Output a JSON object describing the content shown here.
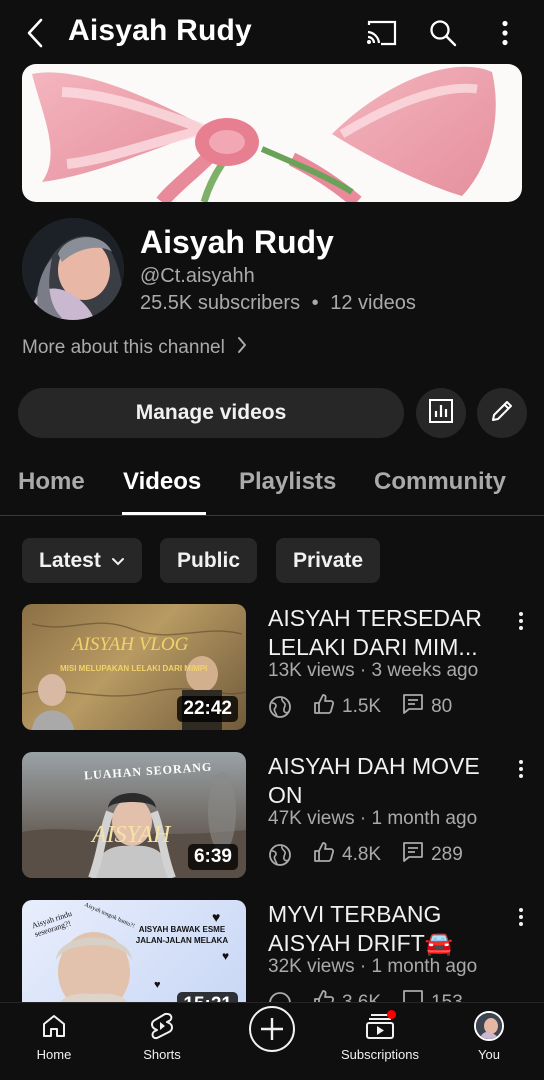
{
  "header": {
    "title": "Aisyah Rudy",
    "icons": [
      "back-icon",
      "cast-icon",
      "search-icon",
      "more-vert-icon"
    ]
  },
  "channel": {
    "name": "Aisyah Rudy",
    "handle": "@Ct.aisyahh",
    "subscribers": "25.5K subscribers",
    "separator": "•",
    "videos": "12 videos",
    "more_link": "More about this channel"
  },
  "actions": {
    "manage_label": "Manage videos",
    "icons": [
      "analytics-icon",
      "edit-icon"
    ]
  },
  "tabs": [
    {
      "label": "Home",
      "active": false
    },
    {
      "label": "Videos",
      "active": true
    },
    {
      "label": "Playlists",
      "active": false
    },
    {
      "label": "Community",
      "active": false
    }
  ],
  "filters": {
    "sort": "Latest",
    "chips": [
      "Public",
      "Private"
    ]
  },
  "videos": [
    {
      "title": "AISYAH TERSEDAR LELAKI DARI MIM...",
      "views": "13K views",
      "age": "3 weeks ago",
      "likes": "1.5K",
      "comments": "80",
      "duration": "22:42",
      "thumb_text": "AISYAH VLOG",
      "thumb_sub": "MISI MELUPAKAN LELAKI DARI MIMPI"
    },
    {
      "title": "AISYAH DAH MOVE ON",
      "views": "47K views",
      "age": "1 month ago",
      "likes": "4.8K",
      "comments": "289",
      "duration": "6:39",
      "thumb_text": "LUAHAN SEORANG",
      "thumb_sub": "AISYAH"
    },
    {
      "title": "MYVI TERBANG AISYAH DRIFT🚘",
      "views": "32K views",
      "age": "1 month ago",
      "likes": "3.6K",
      "comments": "153",
      "duration": "15:21",
      "thumb_text": "AISYAH BAWAK ESME JALAN-JALAN MELAKA",
      "thumb_sub": "Aisyah rindu seseorang?!",
      "thumb_sub2": "Aisyah tengok hantu?!"
    }
  ],
  "nav": [
    {
      "label": "Home",
      "icon": "home-icon"
    },
    {
      "label": "Shorts",
      "icon": "shorts-icon"
    },
    {
      "label": "",
      "icon": "create-icon"
    },
    {
      "label": "Subscriptions",
      "icon": "subscriptions-icon"
    },
    {
      "label": "You",
      "icon": "avatar"
    }
  ],
  "colors": {
    "background": "#0f0f0f",
    "surface": "#272727",
    "text": "#f1f1f1",
    "muted": "#aaaaaa",
    "notification": "#ff0000"
  }
}
